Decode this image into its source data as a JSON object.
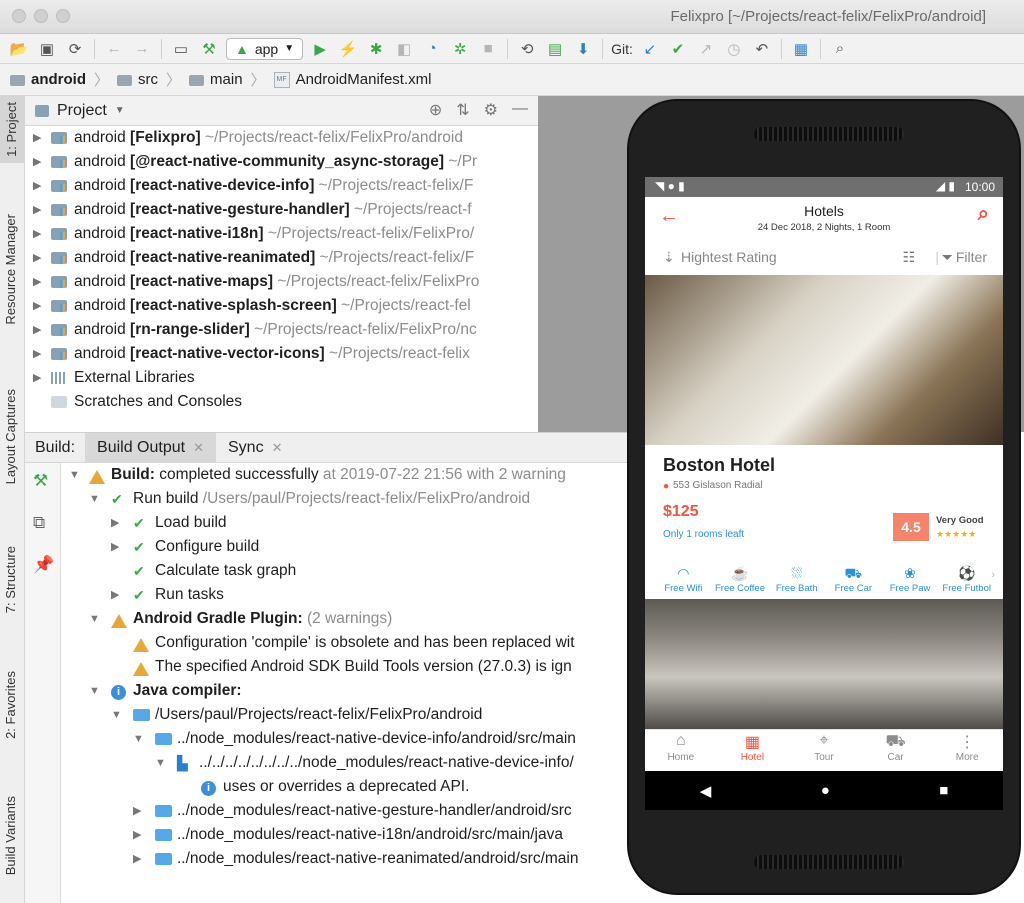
{
  "window": {
    "title": "Felixpro [~/Projects/react-felix/FelixPro/android]"
  },
  "toolbar": {
    "run_config": "app",
    "git_label": "Git:"
  },
  "breadcrumb": [
    "android",
    "src",
    "main",
    "AndroidManifest.xml"
  ],
  "left_tabs": [
    "1: Project",
    "Resource Manager",
    "Layout Captures",
    "7: Structure",
    "2: Favorites",
    "Build Variants"
  ],
  "project": {
    "title": "Project",
    "items": [
      {
        "name": "android",
        "module": "[Felixpro]",
        "path": "~/Projects/react-felix/FelixPro/android"
      },
      {
        "name": "android",
        "module": "[@react-native-community_async-storage]",
        "path": "~/Pr"
      },
      {
        "name": "android",
        "module": "[react-native-device-info]",
        "path": "~/Projects/react-felix/F"
      },
      {
        "name": "android",
        "module": "[react-native-gesture-handler]",
        "path": "~/Projects/react-f"
      },
      {
        "name": "android",
        "module": "[react-native-i18n]",
        "path": "~/Projects/react-felix/FelixPro/"
      },
      {
        "name": "android",
        "module": "[react-native-reanimated]",
        "path": "~/Projects/react-felix/F"
      },
      {
        "name": "android",
        "module": "[react-native-maps]",
        "path": "~/Projects/react-felix/FelixPro"
      },
      {
        "name": "android",
        "module": "[react-native-splash-screen]",
        "path": "~/Projects/react-fel"
      },
      {
        "name": "android",
        "module": "[rn-range-slider]",
        "path": "~/Projects/react-felix/FelixPro/nc"
      },
      {
        "name": "android",
        "module": "[react-native-vector-icons]",
        "path": "~/Projects/react-felix"
      }
    ],
    "external": "External Libraries",
    "scratches": "Scratches and Consoles"
  },
  "build": {
    "label": "Build:",
    "tabs": [
      "Build Output",
      "Sync"
    ],
    "rows": [
      {
        "bold": "Build:",
        "text": " completed successfully",
        "gray": " at 2019-07-22 21:56  with 2 warning"
      },
      {
        "bold": "",
        "text": "Run build ",
        "gray": "/Users/paul/Projects/react-felix/FelixPro/android"
      },
      {
        "text": "Load build"
      },
      {
        "text": "Configure build"
      },
      {
        "text": "Calculate task graph"
      },
      {
        "text": "Run tasks"
      },
      {
        "bold": "Android Gradle Plugin:",
        "gray": " (2 warnings)"
      },
      {
        "text": "Configuration 'compile' is obsolete and has been replaced wit"
      },
      {
        "text": "The specified Android SDK Build Tools version (27.0.3) is ign"
      },
      {
        "bold": "Java compiler:"
      },
      {
        "text": "/Users/paul/Projects/react-felix/FelixPro/android"
      },
      {
        "text": "../node_modules/react-native-device-info/android/src/main"
      },
      {
        "text": "../../../../../../../../node_modules/react-native-device-info/"
      },
      {
        "text": "uses or overrides a deprecated API."
      },
      {
        "text": "../node_modules/react-native-gesture-handler/android/src"
      },
      {
        "text": "../node_modules/react-native-i18n/android/src/main/java"
      },
      {
        "text": "../node_modules/react-native-reanimated/android/src/main"
      }
    ]
  },
  "phone": {
    "status_time": "10:00",
    "title": "Hotels",
    "subtitle": "24 Dec 2018, 2 Nights, 1 Room",
    "sort_label": "Hightest Rating",
    "filter_label": "Filter",
    "hotel": {
      "name": "Boston Hotel",
      "address": "553 Gislason Radial",
      "price": "$125",
      "rooms_left": "Only 1 rooms leaft",
      "score": "4.5",
      "rating_text": "Very Good",
      "stars": "★★★★★",
      "amenities": [
        "Free Wifi",
        "Free Coffee",
        "Free Bath",
        "Free Car",
        "Free Paw",
        "Free Futbol"
      ]
    },
    "bottom_nav": [
      "Home",
      "Hotel",
      "Tour",
      "Car",
      "More"
    ],
    "accent": "#f4543b"
  }
}
